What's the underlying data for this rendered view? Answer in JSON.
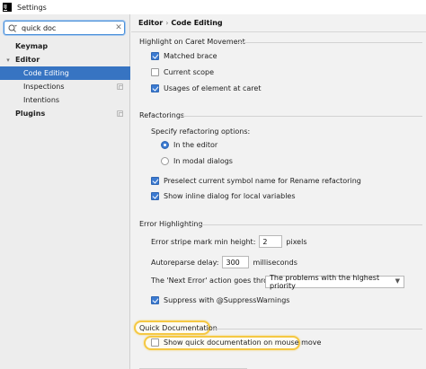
{
  "window": {
    "title": "Settings",
    "app_icon_label": "IJ"
  },
  "sidebar": {
    "search_value": "quick doc",
    "items": [
      {
        "label": "Keymap"
      },
      {
        "label": "Editor"
      },
      {
        "label": "Code Editing"
      },
      {
        "label": "Inspections"
      },
      {
        "label": "Intentions"
      },
      {
        "label": "Plugins"
      }
    ]
  },
  "breadcrumb": {
    "parent": "Editor",
    "separator": "›",
    "current": "Code Editing"
  },
  "highlight_caret": {
    "title": "Highlight on Caret Movement",
    "options": [
      {
        "label": "Matched brace",
        "checked": true
      },
      {
        "label": "Current scope",
        "checked": false
      },
      {
        "label": "Usages of element at caret",
        "checked": true
      }
    ]
  },
  "refactorings": {
    "title": "Refactorings",
    "specify_label": "Specify refactoring options:",
    "radio_in_editor": "In the editor",
    "radio_modal": "In modal dialogs",
    "preselect_label": "Preselect current symbol name for Rename refactoring",
    "inline_dialog_label": "Show inline dialog for local variables"
  },
  "error_highlighting": {
    "title": "Error Highlighting",
    "stripe_label": "Error stripe mark min height:",
    "stripe_value": "2",
    "stripe_unit": "pixels",
    "autoreparse_label": "Autoreparse delay:",
    "autoreparse_value": "300",
    "autoreparse_unit": "milliseconds",
    "next_error_label": "The 'Next Error' action goes through:",
    "next_error_value": "The problems with the highest priority",
    "suppress_label": "Suppress with @SuppressWarnings"
  },
  "quick_doc": {
    "title": "Quick Documentation",
    "mouse_move_label": "Show quick documentation on mouse move"
  },
  "colors": {
    "accent": "#3774c2",
    "highlight": "#f5c842"
  }
}
